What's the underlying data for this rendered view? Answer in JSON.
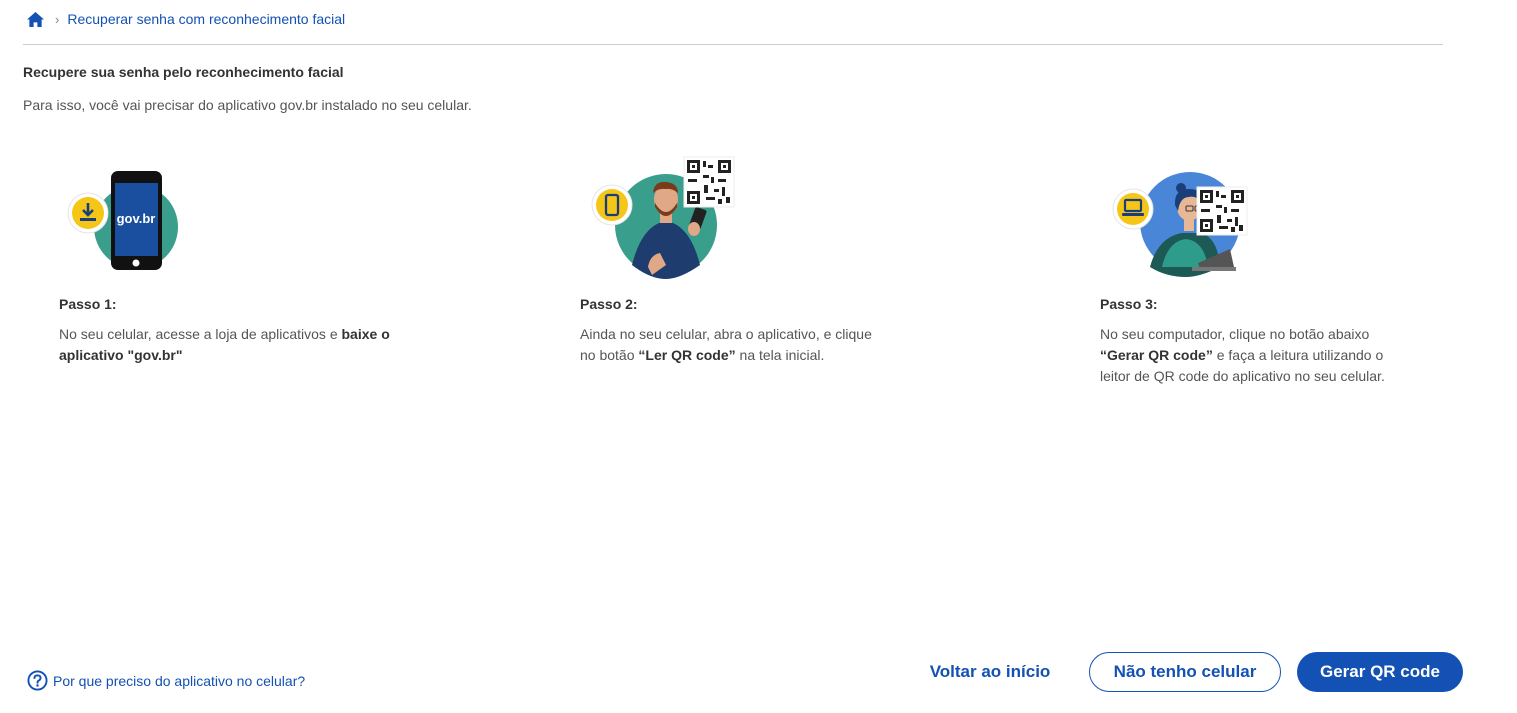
{
  "breadcrumb": {
    "home_icon": "home-icon",
    "separator": "›",
    "current": "Recuperar senha com reconhecimento facial"
  },
  "header": {
    "title": "Recupere sua senha pelo reconhecimento facial",
    "intro": "Para isso, você vai precisar do aplicativo gov.br instalado no seu celular."
  },
  "steps": [
    {
      "title": "Passo 1:",
      "text_before": "No seu celular, acesse a loja de aplicativos e ",
      "text_bold": "baixe o aplicativo \"gov.br\"",
      "text_after": "",
      "phone_screen_label": "gov.br",
      "badge_icon": "download-icon"
    },
    {
      "title": "Passo 2:",
      "text_before": "Ainda no seu celular, abra o aplicativo, e clique no botão ",
      "text_bold": "“Ler QR code”",
      "text_after": " na tela inicial.",
      "badge_icon": "smartphone-icon"
    },
    {
      "title": "Passo 3:",
      "text_before": "No seu computador, clique no botão abaixo ",
      "text_bold": "“Gerar QR code”",
      "text_after": " e faça a leitura utilizando o leitor de QR code do aplicativo no seu celular.",
      "badge_icon": "laptop-icon"
    }
  ],
  "footer": {
    "help_icon": "question-circle-icon",
    "help_text": "Por que preciso do aplicativo no celular?",
    "back_label": "Voltar ao início",
    "no_phone_label": "Não tenho celular",
    "generate_label": "Gerar QR code"
  },
  "colors": {
    "primary": "#1351b4",
    "teal": "#3a9e8c",
    "blue_circle": "#4a86d8",
    "badge_yellow": "#f5c518"
  }
}
